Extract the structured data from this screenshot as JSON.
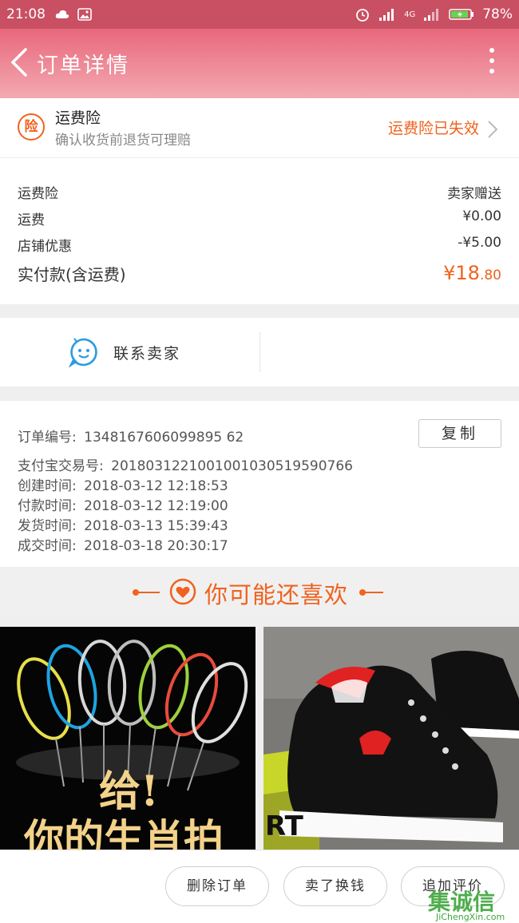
{
  "status_bar": {
    "time": "21:08",
    "network": "4G",
    "battery": "78%",
    "icons": [
      "cloud-icon",
      "image-icon",
      "alarm-icon",
      "signal-icon",
      "battery-icon"
    ]
  },
  "header": {
    "title": "订单详情",
    "icons": [
      "back-chevron-icon",
      "more-vertical-icon"
    ]
  },
  "insurance": {
    "badge": "险",
    "title": "运费险",
    "subtitle": "确认收货前退货可理赔",
    "status": "运费险已失效"
  },
  "fees": {
    "rows": [
      {
        "label": "运费险",
        "value": "卖家赠送"
      },
      {
        "label": "运费",
        "value": "¥0.00"
      },
      {
        "label": "店铺优惠",
        "value": "-¥5.00"
      }
    ],
    "total_label": "实付款(含运费)",
    "total_currency": "¥",
    "total_int": "18",
    "total_dec": ".80"
  },
  "contact": {
    "label": "联系卖家"
  },
  "order_info": {
    "order_no_label": "订单编号:",
    "order_no": "1348167606099895 62",
    "copy_label": "复制",
    "rows": [
      {
        "label": "支付宝交易号:",
        "value": "2018031221001001030519590766"
      },
      {
        "label": "创建时间:",
        "value": "2018-03-12 12:18:53"
      },
      {
        "label": "付款时间:",
        "value": "2018-03-12 12:19:00"
      },
      {
        "label": "发货时间:",
        "value": "2018-03-13 15:39:43"
      },
      {
        "label": "成交时间:",
        "value": "2018-03-18 20:30:17"
      }
    ]
  },
  "recommend": {
    "title": "你可能还喜欢"
  },
  "products": [
    {
      "image_text_1": "给!",
      "image_text_2": "你的生肖拍"
    },
    {
      "image_text": "RT"
    }
  ],
  "bottom_bar": {
    "delete_label": "删除订单",
    "resell_label": "卖了换钱",
    "review_label": "追加评价"
  },
  "watermark": {
    "logo": "集诚信",
    "url": "JiChengXin.com"
  },
  "colors": {
    "accent": "#f0621e",
    "header": "#e8687b",
    "status_bar": "#c94f63",
    "contact_icon": "#2b9be0"
  }
}
